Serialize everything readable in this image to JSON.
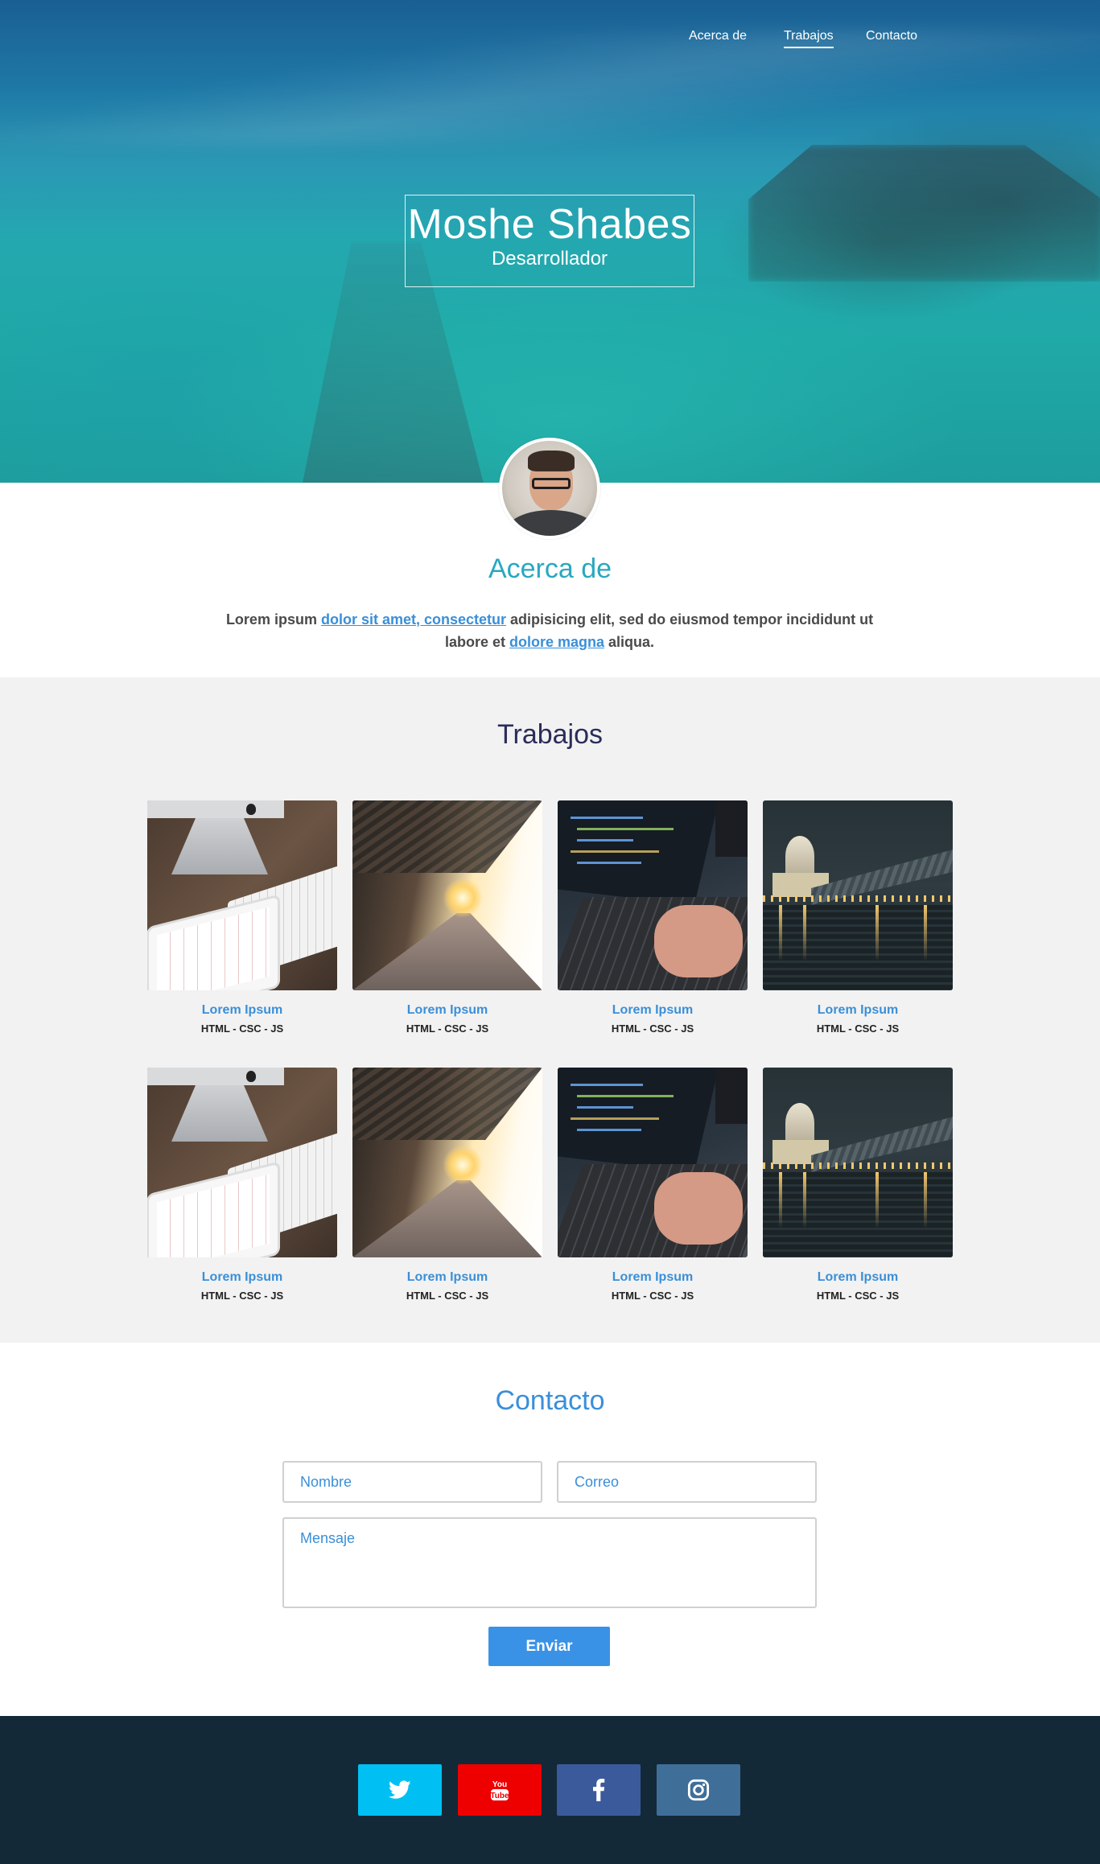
{
  "nav": {
    "items": [
      {
        "label": "Acerca de",
        "active": false
      },
      {
        "label": "Trabajos",
        "active": true
      },
      {
        "label": "Contacto",
        "active": false
      }
    ]
  },
  "hero": {
    "name": "Moshe Shabes",
    "role": "Desarrollador"
  },
  "about": {
    "title": "Acerca de",
    "text_parts": {
      "p1": "Lorem ipsum ",
      "link1": "dolor sit amet, consectetur",
      "p2": " adipisicing elit, sed do eiusmod tempor incididunt ut labore et ",
      "link2": "dolore magna",
      "p3": " aliqua."
    }
  },
  "works": {
    "title": "Trabajos",
    "items": [
      {
        "title": "Lorem Ipsum",
        "tags": "HTML - CSC - JS",
        "image": "desk-image"
      },
      {
        "title": "Lorem Ipsum",
        "tags": "HTML - CSC - JS",
        "image": "train-station-image"
      },
      {
        "title": "Lorem Ipsum",
        "tags": "HTML - CSC - JS",
        "image": "laptop-code-image"
      },
      {
        "title": "Lorem Ipsum",
        "tags": "HTML - CSC - JS",
        "image": "city-night-image"
      },
      {
        "title": "Lorem Ipsum",
        "tags": "HTML - CSC - JS",
        "image": "desk-image"
      },
      {
        "title": "Lorem Ipsum",
        "tags": "HTML - CSC - JS",
        "image": "train-station-image"
      },
      {
        "title": "Lorem Ipsum",
        "tags": "HTML - CSC - JS",
        "image": "laptop-code-image"
      },
      {
        "title": "Lorem Ipsum",
        "tags": "HTML - CSC - JS",
        "image": "city-night-image"
      }
    ]
  },
  "contact": {
    "title": "Contacto",
    "name_placeholder": "Nombre",
    "email_placeholder": "Correo",
    "message_placeholder": "Mensaje",
    "submit_label": "Enviar"
  },
  "footer": {
    "social": [
      {
        "icon": "twitter-icon",
        "color": "#00bff3"
      },
      {
        "icon": "youtube-icon",
        "color": "#ee0000"
      },
      {
        "icon": "facebook-icon",
        "color": "#3b5a9b"
      },
      {
        "icon": "instagram-icon",
        "color": "#3f6e99"
      }
    ]
  },
  "colors": {
    "accent": "#3a8fd8",
    "about_title": "#29a8c0",
    "works_bg": "#f2f2f2",
    "footer_bg": "#132937"
  }
}
